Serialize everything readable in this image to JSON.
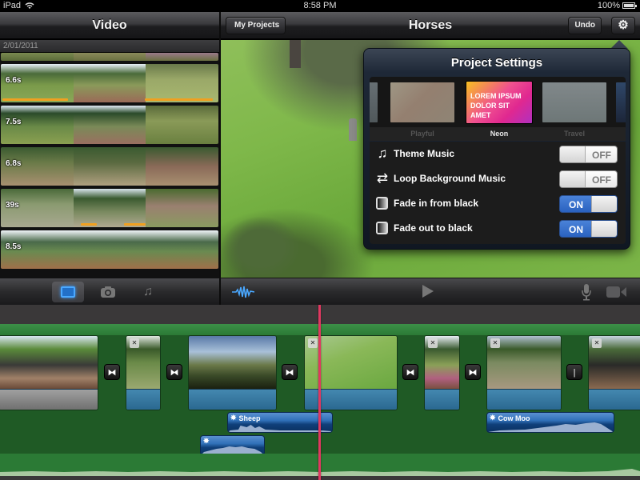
{
  "status_bar": {
    "device": "iPad",
    "wifi_icon": "wifi-icon",
    "time": "8:58 PM",
    "battery": "100%",
    "battery_icon": "battery-icon"
  },
  "left_panel": {
    "title": "Video",
    "date_header": "2/01/2011",
    "clips": [
      {
        "duration": "",
        "partial": true
      },
      {
        "duration": "6.6s",
        "used": true
      },
      {
        "duration": "7.5s",
        "used": false
      },
      {
        "duration": "6.8s",
        "used": false
      },
      {
        "duration": "39s",
        "used": true
      },
      {
        "duration": "8.5s",
        "used": false
      }
    ]
  },
  "project": {
    "back_label": "My Projects",
    "title": "Horses",
    "undo_label": "Undo",
    "settings_icon": "gear-icon"
  },
  "project_settings": {
    "title": "Project Settings",
    "themes": [
      {
        "name": "Playful",
        "selected": false
      },
      {
        "name": "Neon",
        "selected": true,
        "preview_text": [
          "LOREM IPSUM",
          "DOLOR SIT",
          "AMET"
        ]
      },
      {
        "name": "Travel",
        "selected": false
      }
    ],
    "options": [
      {
        "label": "Theme Music",
        "icon": "music-note-icon",
        "state": "OFF"
      },
      {
        "label": "Loop Background Music",
        "icon": "loop-icon",
        "state": "OFF"
      },
      {
        "label": "Fade in from black",
        "icon": "fade-icon",
        "state": "ON"
      },
      {
        "label": "Fade out to black",
        "icon": "fade-icon",
        "state": "ON"
      }
    ]
  },
  "toolbar": {
    "media_tabs": [
      {
        "name": "video",
        "icon": "video-icon",
        "active": true
      },
      {
        "name": "photos",
        "icon": "camera-icon",
        "active": false
      },
      {
        "name": "audio",
        "icon": "music-note-icon",
        "active": false
      }
    ],
    "waveform_icon": "waveform-icon",
    "play_icon": "play-icon",
    "mic_icon": "microphone-icon",
    "camera_icon": "video-camera-icon"
  },
  "timeline": {
    "sound_effects": [
      {
        "label": "Sheep"
      },
      {
        "label": ""
      },
      {
        "label": "Cow Moo"
      }
    ],
    "transition_glyph": "⧓",
    "cut_glyph": "|"
  },
  "colors": {
    "accent_blue": "#2a62c0",
    "timeline_green": "#1f5a25",
    "playhead": "#e03860",
    "used_marker": "#f0a020"
  }
}
